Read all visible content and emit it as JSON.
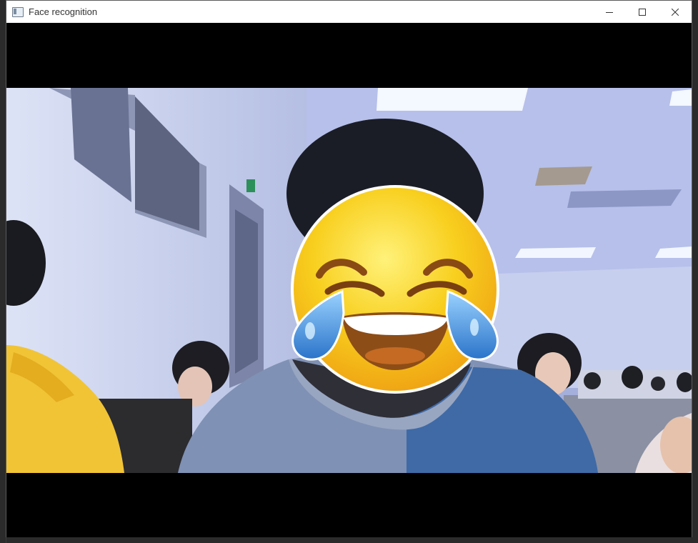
{
  "window": {
    "title": "Face recognition",
    "controls": [
      "minimize",
      "maximize",
      "close"
    ]
  },
  "canvas": {
    "content": "webcam-frame-with-emoji-overlay",
    "overlay_icon": "face-with-tears-of-joy-emoji"
  },
  "colors": {
    "titlebar_bg": "#ffffff",
    "canvas_bg": "#000000",
    "emoji_yellow": "#f6c21d",
    "sweater_blue": "#3f6aa6",
    "hoodie_yellow": "#f1c436"
  }
}
